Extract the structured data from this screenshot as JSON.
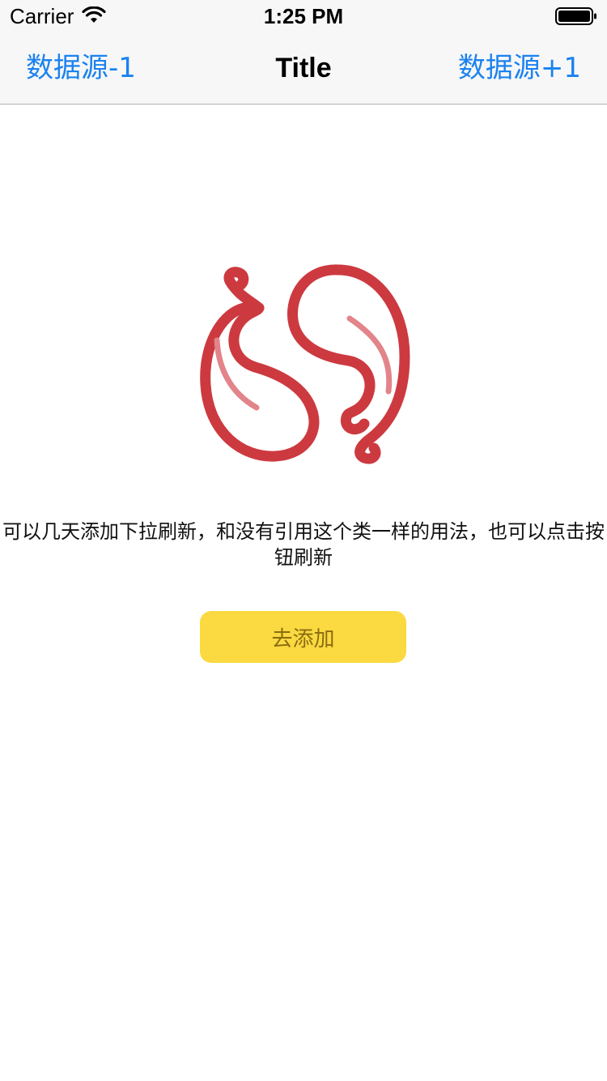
{
  "status_bar": {
    "carrier": "Carrier",
    "time": "1:25 PM",
    "wifi_icon": "wifi-icon",
    "battery_icon": "battery-icon"
  },
  "nav_bar": {
    "left_button": "数据源-1",
    "title": "Title",
    "right_button": "数据源+1",
    "tint_color": "#1a82f0"
  },
  "empty_state": {
    "illustration_icon": "paisley-icon",
    "illustration_color": "#cc3a40",
    "message": "可以几天添加下拉刷新，和没有引用这个类一样的用法，也可以点击按钮刷新",
    "button_label": "去添加",
    "button_color": "#fbd940"
  }
}
